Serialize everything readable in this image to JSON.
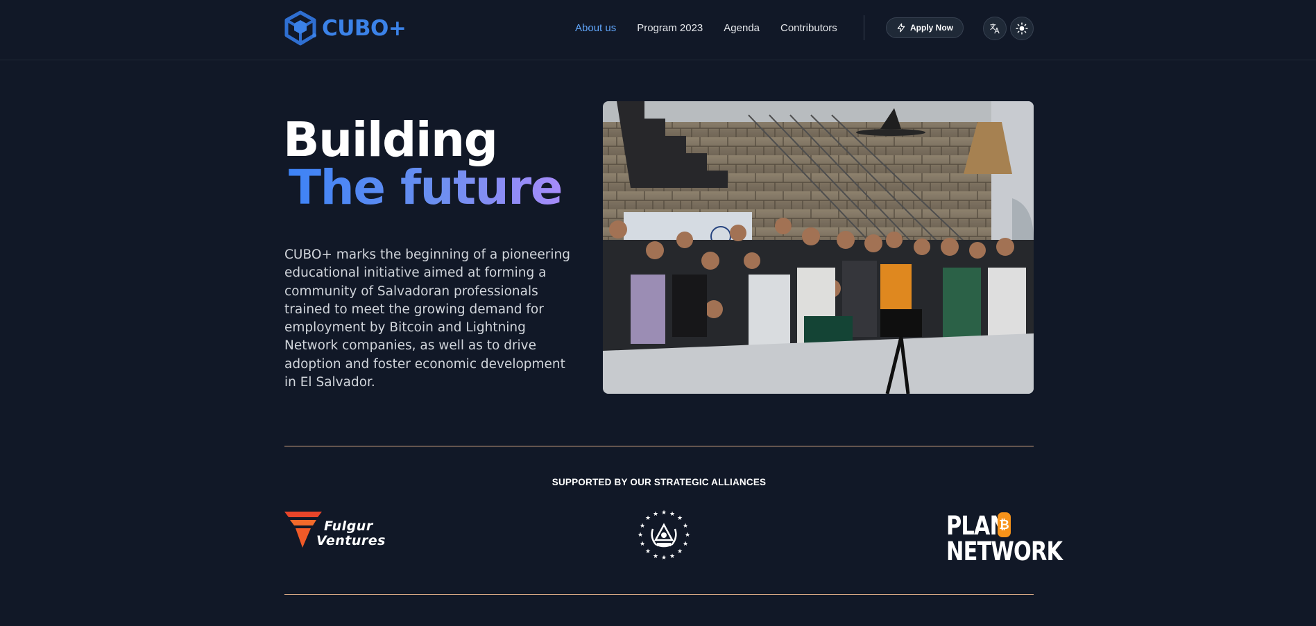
{
  "brand": {
    "name": "CUBO+",
    "logo_icon": "cube-logo-icon",
    "accent": "#3b82e8"
  },
  "nav": {
    "items": [
      {
        "label": "About us",
        "active": true
      },
      {
        "label": "Program 2023",
        "active": false
      },
      {
        "label": "Agenda",
        "active": false
      },
      {
        "label": "Contributors",
        "active": false
      }
    ],
    "apply_label": "Apply Now",
    "apply_icon": "bolt-icon",
    "language_icon": "translate-icon",
    "theme_icon": "sun-icon"
  },
  "hero": {
    "title_line1": "Building",
    "title_line2": "The future",
    "description": "CUBO+ marks the beginning of a pioneering educational initiative aimed at forming a community of Salvadoran professionals trained to meet the growing demand for employment by Bitcoin and Lightning Network companies, as well as to drive adoption and foster economic development in El Salvador.",
    "photo": "group-photo"
  },
  "alliances": {
    "title": "SUPPORTED BY OUR STRATEGIC ALLIANCES",
    "partners": [
      {
        "name_line1": "Fulgur",
        "name_line2": "Ventures",
        "logo": "fulgur-ventures-logo",
        "color": "#f05a28"
      },
      {
        "name": "El Salvador government seal",
        "logo": "el-salvador-seal-logo"
      },
      {
        "name_line1": "PLAN",
        "badge": "₿",
        "name_line2": "NETWORK",
        "logo": "plan-b-network-logo",
        "color": "#f7931a"
      }
    ]
  },
  "colors": {
    "background": "#111827",
    "link_active": "#60a5fa",
    "rule": "#d6a784",
    "gradient_start": "#3b82f6",
    "gradient_end": "#a78bfa"
  }
}
